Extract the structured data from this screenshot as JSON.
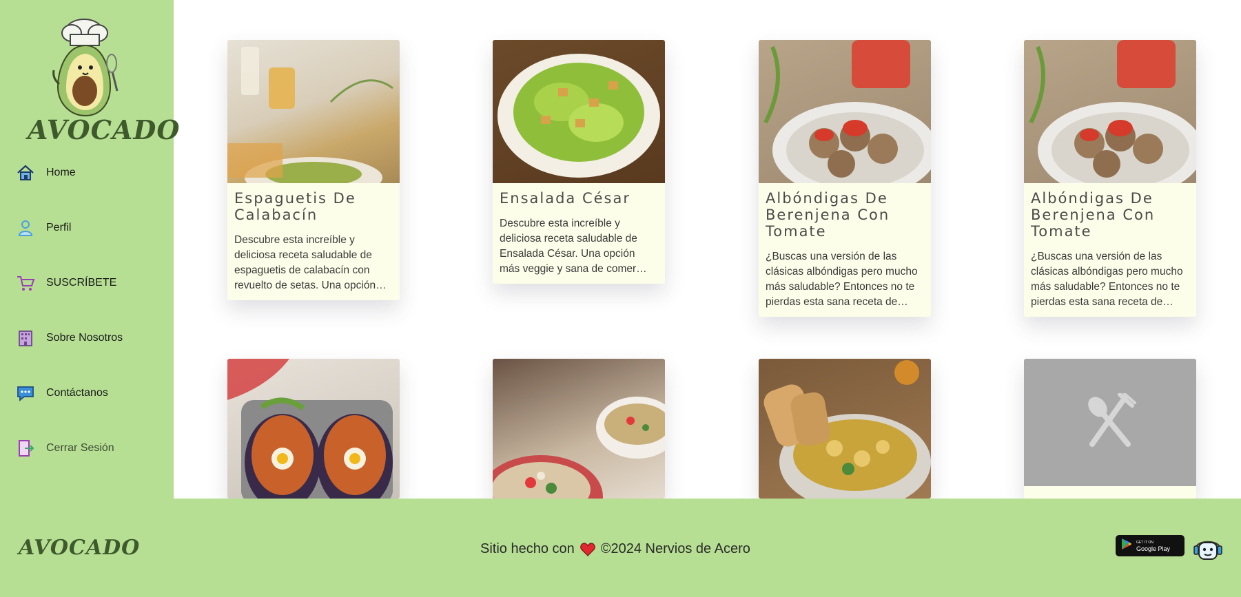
{
  "brand": {
    "name": "AVOCADO",
    "accent": "#b6df93",
    "brand_text": "#3e5a2d"
  },
  "nav": [
    {
      "label": "Home",
      "icon": "home-icon"
    },
    {
      "label": "Perfil",
      "icon": "user-icon"
    },
    {
      "label": "SUSCRÍBETE",
      "icon": "cart-icon"
    },
    {
      "label": "Sobre Nosotros",
      "icon": "building-icon"
    },
    {
      "label": "Contáctanos",
      "icon": "chat-icon"
    },
    {
      "label": "Cerrar Sesión",
      "icon": "logout-icon"
    }
  ],
  "cards": [
    {
      "title": "Espaguetis De Calabacín",
      "desc": "Descubre esta increíble y deliciosa receta saludable de espaguetis de calabacín con revuelto de setas. Una opción…"
    },
    {
      "title": "Ensalada César",
      "desc": "Descubre esta increíble y deliciosa receta saludable de Ensalada César. Una opción más veggie y sana de comer pasta…"
    },
    {
      "title": "Albóndigas De Berenjena Con Tomate",
      "desc": "¿Buscas una versión de las clásicas albóndigas pero mucho más saludable? Entonces no te pierdas esta sana receta de…"
    },
    {
      "title": "Albóndigas De Berenjena Con Tomate",
      "desc": "¿Buscas una versión de las clásicas albóndigas pero mucho más saludable? Entonces no te pierdas esta sana receta de…"
    },
    {
      "title": "",
      "desc": ""
    },
    {
      "title": "",
      "desc": ""
    },
    {
      "title": "",
      "desc": ""
    },
    {
      "title": "",
      "desc": ""
    }
  ],
  "footer": {
    "logo": "AVOCADO",
    "made_with": "Sitio hecho con",
    "copyright": "©2024 Nervios de Acero",
    "store_small": "GET IT ON",
    "store_label": "Google Play"
  }
}
